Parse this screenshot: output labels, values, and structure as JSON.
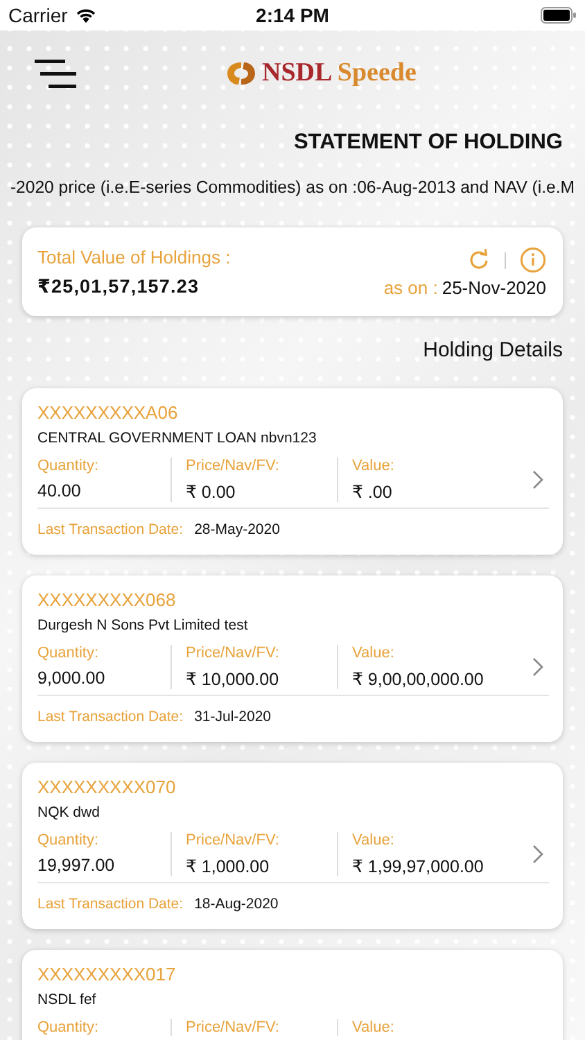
{
  "status_bar": {
    "carrier": "Carrier",
    "time": "2:14 PM"
  },
  "header": {
    "brand": "NSDL",
    "brand_sub": "Speede"
  },
  "title": "STATEMENT OF HOLDING",
  "ticker": "-2020 price (i.e.E-series Commodities) as on :06-Aug-2013 and NAV (i.e.M",
  "summary": {
    "label": "Total Value of Holdings :",
    "amount": "₹25,01,57,157.23",
    "as_on_label": "as on :",
    "as_on_date": "25-Nov-2020"
  },
  "section_title": "Holding Details",
  "holdings": [
    {
      "account": "XXXXXXXXXA06",
      "name": "CENTRAL GOVERNMENT LOAN nbvn123",
      "fields": [
        {
          "label": "Quantity:",
          "value": "40.00"
        },
        {
          "label": "Price/Nav/FV:",
          "value": "₹ 0.00"
        },
        {
          "label": "Value:",
          "value": "₹ .00"
        }
      ],
      "last_txn_label": "Last Transaction Date:",
      "last_txn_date": "28-May-2020"
    },
    {
      "account": "XXXXXXXXX068",
      "name": "Durgesh N Sons Pvt Limited test",
      "fields": [
        {
          "label": "Quantity:",
          "value": "9,000.00"
        },
        {
          "label": "Price/Nav/FV:",
          "value": "₹ 10,000.00"
        },
        {
          "label": "Value:",
          "value": "₹ 9,00,00,000.00"
        }
      ],
      "last_txn_label": "Last Transaction Date:",
      "last_txn_date": "31-Jul-2020"
    },
    {
      "account": "XXXXXXXXX070",
      "name": "NQK dwd",
      "fields": [
        {
          "label": "Quantity:",
          "value": "19,997.00"
        },
        {
          "label": "Price/Nav/FV:",
          "value": "₹ 1,000.00"
        },
        {
          "label": "Value:",
          "value": "₹ 1,99,97,000.00"
        }
      ],
      "last_txn_label": "Last Transaction Date:",
      "last_txn_date": "18-Aug-2020"
    },
    {
      "account": "XXXXXXXXX017",
      "name": "NSDL fef",
      "fields": [
        {
          "label": "Quantity:"
        },
        {
          "label": "Price/Nav/FV:"
        },
        {
          "label": "Value:"
        }
      ]
    }
  ]
}
